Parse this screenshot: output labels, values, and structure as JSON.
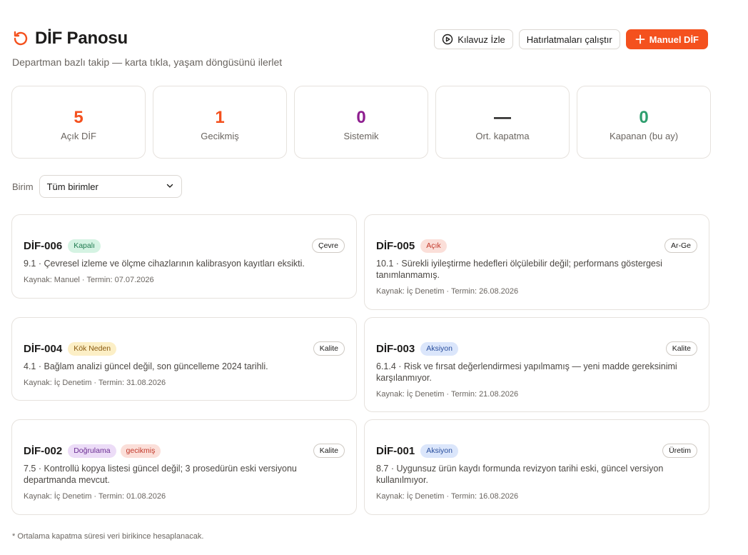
{
  "header": {
    "title": "DİF Panosu",
    "subtitle": "Departman bazlı takip — karta tıkla, yaşam döngüsünü ilerlet",
    "title_icon": "refresh-icon",
    "accent": "#f4511e"
  },
  "actions": {
    "guide_label": "Kılavuz İzle",
    "reminders_label": "Hatırlatmaları çalıştır",
    "manual_label": "Manuel DİF"
  },
  "stats": [
    {
      "value": "5",
      "label": "Açık DİF",
      "color": "#f4511e"
    },
    {
      "value": "1",
      "label": "Gecikmiş",
      "color": "#f4511e"
    },
    {
      "value": "0",
      "label": "Sistemik",
      "color": "#8e1e8f"
    },
    {
      "value": "—",
      "label": "Ort. kapatma",
      "color": "#1c1b1a"
    },
    {
      "value": "0",
      "label": "Kapanan (bu ay)",
      "color": "#2e9e6e"
    }
  ],
  "filter": {
    "label": "Birim",
    "selected": "Tüm birimler"
  },
  "cards": [
    {
      "id": "DİF-006",
      "badges": [
        "Kapalı"
      ],
      "dept": "Çevre",
      "desc": "9.1 · Çevresel izleme ve ölçme cihazlarının kalibrasyon kayıtları eksikti.",
      "meta": "Kaynak: Manuel · Termin: 07.07.2026"
    },
    {
      "id": "DİF-005",
      "badges": [
        "Açık"
      ],
      "dept": "Ar-Ge",
      "desc": "10.1 · Sürekli iyileştirme hedefleri ölçülebilir değil; performans göstergesi tanımlanmamış.",
      "meta": "Kaynak: İç Denetim · Termin: 26.08.2026"
    },
    {
      "id": "DİF-004",
      "badges": [
        "Kök Neden"
      ],
      "dept": "Kalite",
      "desc": "4.1 · Bağlam analizi güncel değil, son güncelleme 2024 tarihli.",
      "meta": "Kaynak: İç Denetim · Termin: 31.08.2026"
    },
    {
      "id": "DİF-003",
      "badges": [
        "Aksiyon"
      ],
      "dept": "Kalite",
      "desc": "6.1.4 · Risk ve fırsat değerlendirmesi yapılmamış — yeni madde gereksinimi karşılanmıyor.",
      "meta": "Kaynak: İç Denetim · Termin: 21.08.2026"
    },
    {
      "id": "DİF-002",
      "badges": [
        "Doğrulama",
        "gecikmiş"
      ],
      "dept": "Kalite",
      "desc": "7.5 · Kontrollü kopya listesi güncel değil; 3 prosedürün eski versiyonu departmanda mevcut.",
      "meta": "Kaynak: İç Denetim · Termin: 01.08.2026"
    },
    {
      "id": "DİF-001",
      "badges": [
        "Aksiyon"
      ],
      "dept": "Üretim",
      "desc": "8.7 · Uygunsuz ürün kaydı formunda revizyon tarihi eski, güncel versiyon kullanılmıyor.",
      "meta": "Kaynak: İç Denetim · Termin: 16.08.2026"
    }
  ],
  "footnote": "* Ortalama kapatma süresi veri birikince hesaplanacak."
}
